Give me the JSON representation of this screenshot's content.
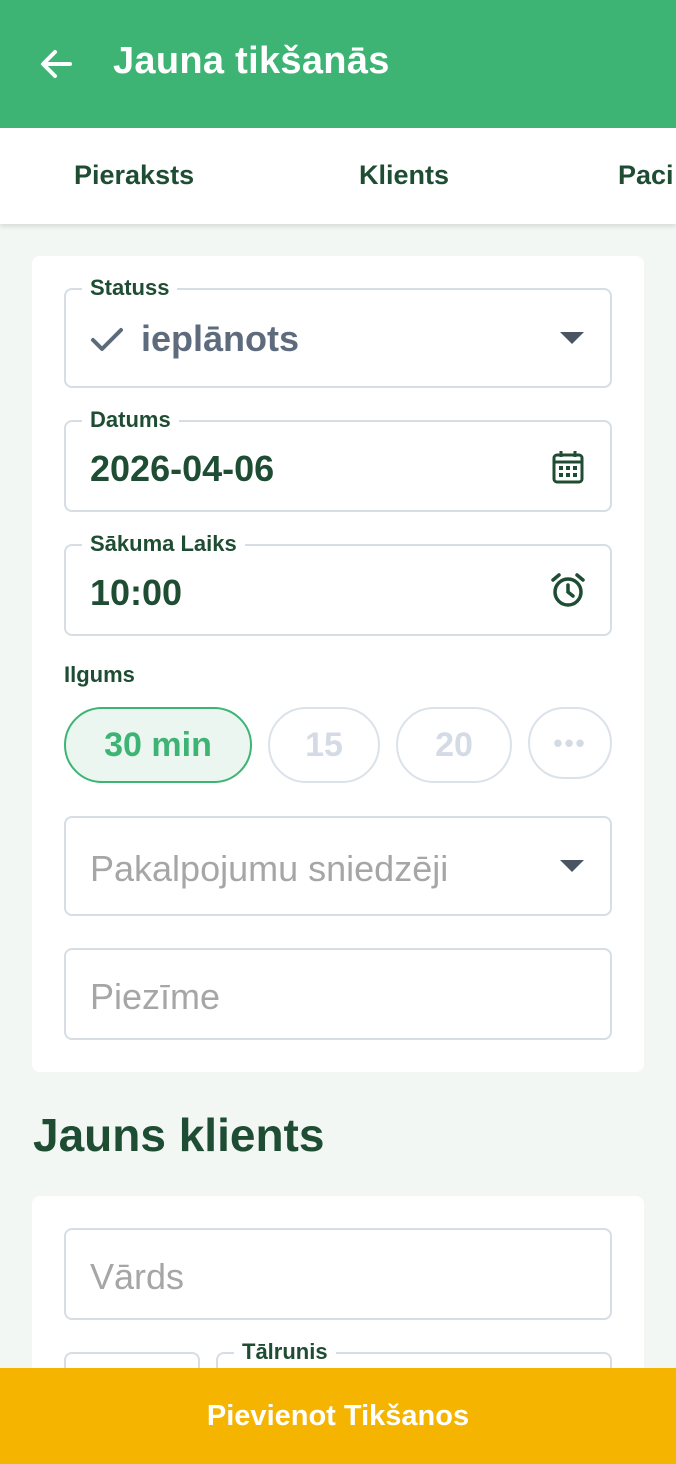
{
  "header": {
    "title": "Jauna tikšanās",
    "back_icon": "arrow-left-icon",
    "color": "#3db474"
  },
  "tabs": [
    {
      "label": "Pieraksts"
    },
    {
      "label": "Klients"
    },
    {
      "label": "Paci"
    }
  ],
  "appointment": {
    "status_label": "Statuss",
    "status_value": "ieplānots",
    "date_label": "Datums",
    "date_value": "2026-04-06",
    "start_time_label": "Sākuma Laiks",
    "start_time_value": "10:00",
    "duration_label": "Ilgums",
    "duration_options": [
      {
        "label": "30 min",
        "selected": true
      },
      {
        "label": "15",
        "selected": false
      },
      {
        "label": "20",
        "selected": false
      },
      {
        "label": "•••",
        "selected": false
      }
    ],
    "providers_placeholder": "Pakalpojumu sniedzēji",
    "note_placeholder": "Piezīme"
  },
  "client": {
    "heading": "Jauns klients",
    "name_placeholder": "Vārds",
    "phone_label": "Tālrunis"
  },
  "submit": {
    "label": "Pievienot Tikšanos",
    "color": "#f4b400"
  }
}
